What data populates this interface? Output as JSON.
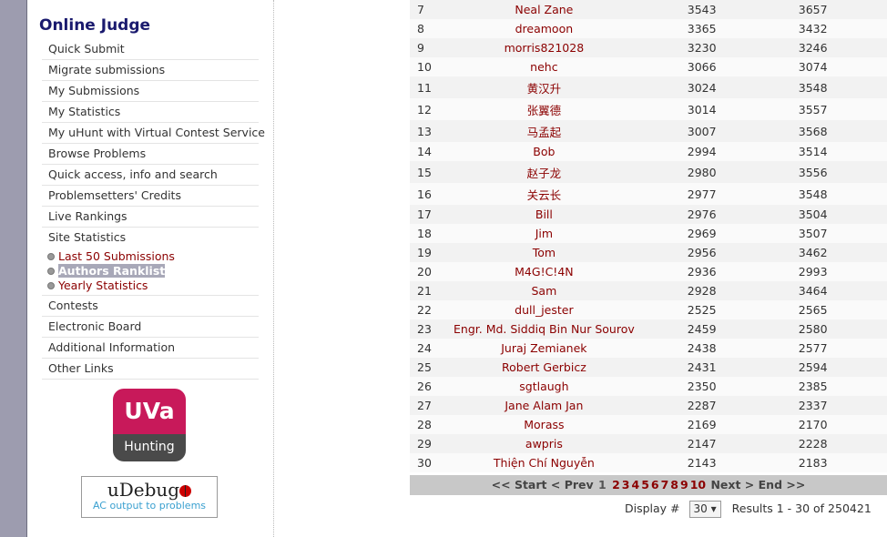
{
  "sidebar": {
    "title": "Online Judge",
    "items": [
      {
        "label": "Quick Submit"
      },
      {
        "label": "Migrate submissions"
      },
      {
        "label": "My Submissions"
      },
      {
        "label": "My Statistics"
      },
      {
        "label": "My uHunt with Virtual Contest Service"
      },
      {
        "label": "Browse Problems"
      },
      {
        "label": "Quick access, info and search"
      },
      {
        "label": "Problemsetters' Credits"
      },
      {
        "label": "Live Rankings"
      },
      {
        "label": "Site Statistics"
      }
    ],
    "site_statistics_sub": [
      {
        "label": "Last 50 Submissions"
      },
      {
        "label": "Authors Ranklist"
      },
      {
        "label": "Yearly Statistics"
      }
    ],
    "items_after": [
      {
        "label": "Contests"
      },
      {
        "label": "Electronic Board"
      },
      {
        "label": "Additional Information"
      },
      {
        "label": "Other Links"
      }
    ],
    "uva_logo": {
      "top": "UVa",
      "bottom": "Hunting"
    },
    "udebug": {
      "title": "uDebug",
      "subtitle": "AC output to problems"
    }
  },
  "ranklist": {
    "rows": [
      {
        "rank": "7",
        "name": "Neal Zane",
        "v1": "3543",
        "v2": "3657"
      },
      {
        "rank": "8",
        "name": "dreamoon",
        "v1": "3365",
        "v2": "3432"
      },
      {
        "rank": "9",
        "name": "morris821028",
        "v1": "3230",
        "v2": "3246"
      },
      {
        "rank": "10",
        "name": "nehc",
        "v1": "3066",
        "v2": "3074"
      },
      {
        "rank": "11",
        "name": "黄汉升",
        "v1": "3024",
        "v2": "3548"
      },
      {
        "rank": "12",
        "name": "张翼德",
        "v1": "3014",
        "v2": "3557"
      },
      {
        "rank": "13",
        "name": "马孟起",
        "v1": "3007",
        "v2": "3568"
      },
      {
        "rank": "14",
        "name": "Bob",
        "v1": "2994",
        "v2": "3514"
      },
      {
        "rank": "15",
        "name": "赵子龙",
        "v1": "2980",
        "v2": "3556"
      },
      {
        "rank": "16",
        "name": "关云长",
        "v1": "2977",
        "v2": "3548"
      },
      {
        "rank": "17",
        "name": "Bill",
        "v1": "2976",
        "v2": "3504"
      },
      {
        "rank": "18",
        "name": "Jim",
        "v1": "2969",
        "v2": "3507"
      },
      {
        "rank": "19",
        "name": "Tom",
        "v1": "2956",
        "v2": "3462"
      },
      {
        "rank": "20",
        "name": "M4G!C!4N",
        "v1": "2936",
        "v2": "2993"
      },
      {
        "rank": "21",
        "name": "Sam",
        "v1": "2928",
        "v2": "3464"
      },
      {
        "rank": "22",
        "name": "dull_jester",
        "v1": "2525",
        "v2": "2565"
      },
      {
        "rank": "23",
        "name": "Engr. Md. Siddiq Bin Nur Sourov",
        "v1": "2459",
        "v2": "2580"
      },
      {
        "rank": "24",
        "name": "Juraj Zemianek",
        "v1": "2438",
        "v2": "2577"
      },
      {
        "rank": "25",
        "name": "Robert Gerbicz",
        "v1": "2431",
        "v2": "2594"
      },
      {
        "rank": "26",
        "name": "sgtlaugh",
        "v1": "2350",
        "v2": "2385"
      },
      {
        "rank": "27",
        "name": "Jane Alam Jan",
        "v1": "2287",
        "v2": "2337"
      },
      {
        "rank": "28",
        "name": "Morass",
        "v1": "2169",
        "v2": "2170"
      },
      {
        "rank": "29",
        "name": "awpris",
        "v1": "2147",
        "v2": "2228"
      },
      {
        "rank": "30",
        "name": "Thiện Chí Nguyễn",
        "v1": "2143",
        "v2": "2183"
      }
    ]
  },
  "pager": {
    "start": "<< Start",
    "prev": "< Prev",
    "current": "1",
    "pages": [
      "2",
      "3",
      "4",
      "5",
      "6",
      "7",
      "8",
      "9",
      "10"
    ],
    "next": "Next >",
    "end": "End >>"
  },
  "display": {
    "label": "Display #",
    "value": "30",
    "results": "Results 1 - 30 of 250421"
  }
}
